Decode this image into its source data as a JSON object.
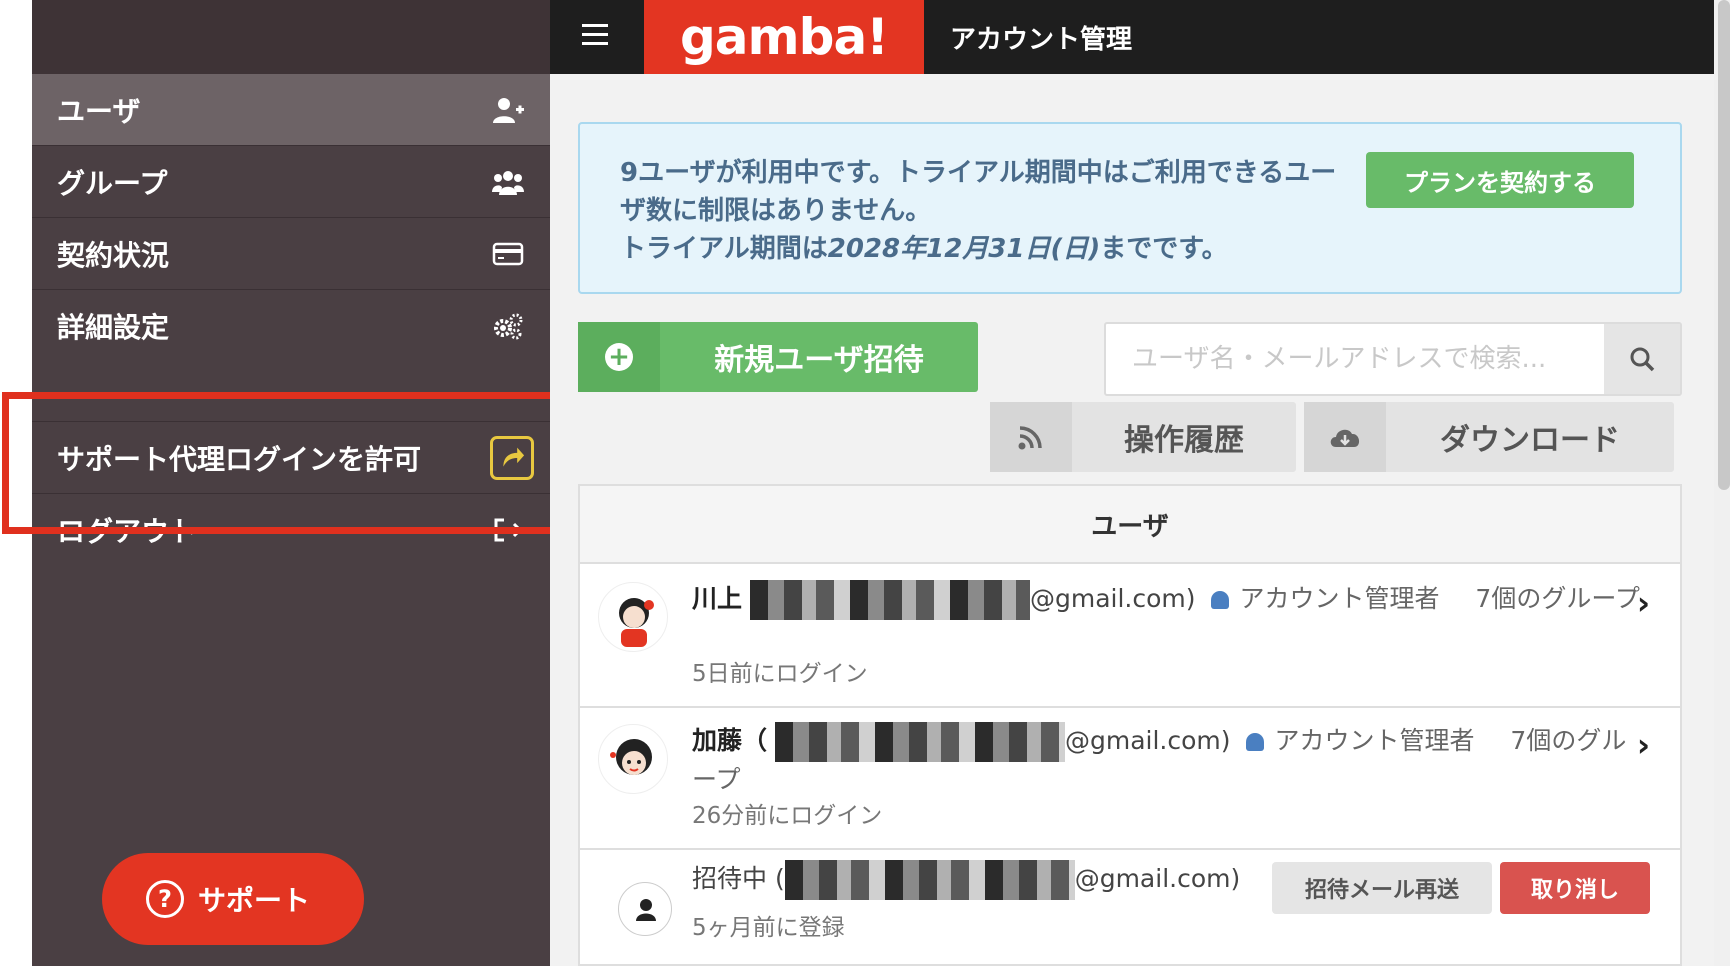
{
  "header": {
    "logo": "gamba!",
    "title": "アカウント管理"
  },
  "sidebar": {
    "items": [
      {
        "label": "ユーザ",
        "icon": "user-plus-icon",
        "active": true
      },
      {
        "label": "グループ",
        "icon": "users-icon"
      },
      {
        "label": "契約状況",
        "icon": "credit-card-icon"
      },
      {
        "label": "詳細設定",
        "icon": "cogs-icon"
      },
      {
        "label": "サポート代理ログインを許可",
        "icon": "share-icon"
      },
      {
        "label": "ログアウト",
        "icon": "logout-icon"
      }
    ],
    "support_button": "サポート"
  },
  "notice": {
    "line1": "9ユーザが利用中です。トライアル期間中はご利用できるユーザ数に制限はありません。",
    "line2_prefix": "トライアル期間は",
    "line2_date": "2028年12月31日(日)",
    "line2_suffix": "までです。",
    "plan_button": "プランを契約する"
  },
  "toolbar": {
    "invite_button": "新規ユーザ招待",
    "search_placeholder": "ユーザ名・メールアドレスで検索...",
    "history_button": "操作履歴",
    "download_button": "ダウンロード"
  },
  "users_panel": {
    "header": "ユーザ",
    "rows": [
      {
        "name": "川上",
        "email_suffix": "@gmail.com)",
        "role": "アカウント管理者",
        "groups": "7個のグループ",
        "last_login": "5日前にログイン"
      },
      {
        "name": "加藤（",
        "email_suffix": "@gmail.com)",
        "role": "アカウント管理者",
        "groups": "7個のグループ",
        "last_login": "26分前にログイン"
      },
      {
        "name": "招待中 (",
        "email_suffix": "@gmail.com)",
        "registered": "5ヶ月前に登録",
        "resend_button": "招待メール再送",
        "cancel_button": "取り消し"
      }
    ]
  },
  "colors": {
    "brand_red": "#e33522",
    "sidebar_bg": "#4a3f43",
    "green": "#68bb69",
    "highlight": "#e0301e"
  }
}
